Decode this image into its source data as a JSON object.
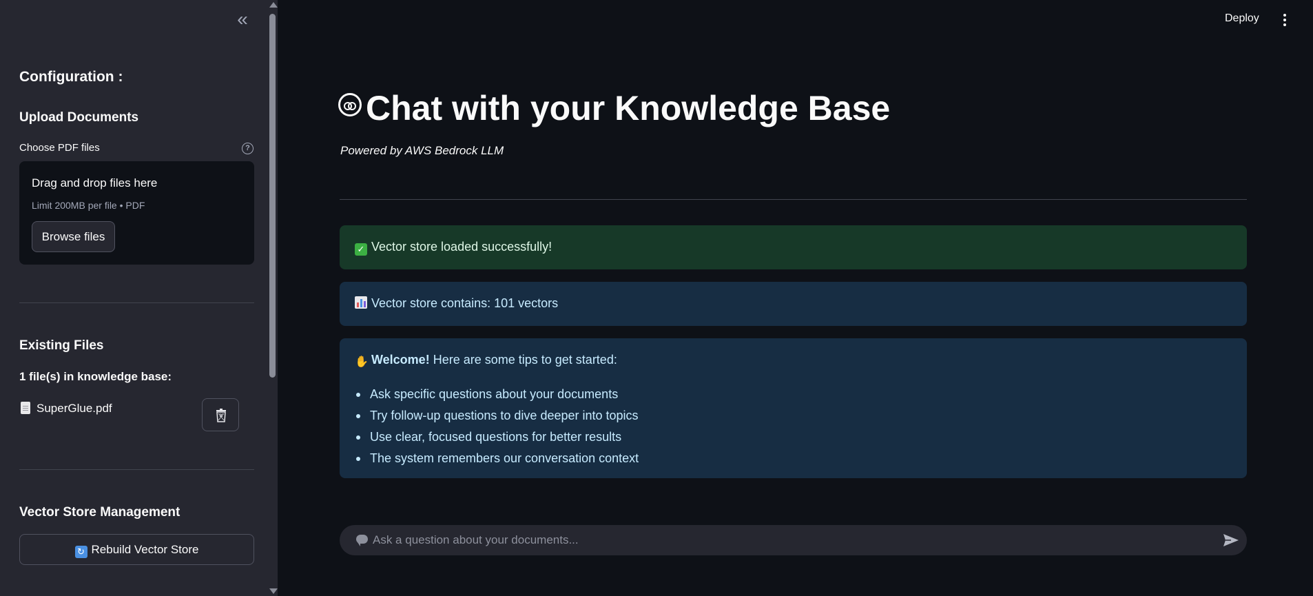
{
  "sidebar": {
    "collapse_label": "«",
    "heading": "Configuration :",
    "upload": {
      "heading": "Upload Documents",
      "label": "Choose PDF files",
      "help_icon": "question-icon",
      "dropzone_title": "Drag and drop files here",
      "dropzone_limit": "Limit 200MB per file • PDF",
      "browse_label": "Browse files"
    },
    "existing": {
      "heading": "Existing Files",
      "count_text": "1 file(s) in knowledge base:",
      "files": [
        {
          "name": "SuperGlue.pdf",
          "icon": "document-icon"
        }
      ],
      "delete_icon": "trash-icon"
    },
    "vector_store": {
      "heading": "Vector Store Management",
      "rebuild_label": "Rebuild Vector Store",
      "rebuild_icon": "refresh-icon"
    }
  },
  "header": {
    "deploy_label": "Deploy",
    "menu_icon": "kebab-menu-icon"
  },
  "main": {
    "title": "Chat with your Knowledge Base",
    "title_icon": "robot-face-icon",
    "subtitle": "Powered by AWS Bedrock LLM",
    "alerts": {
      "success": "Vector store loaded successfully!",
      "count": "Vector store contains: 101 vectors",
      "welcome_bold": "Welcome!",
      "welcome_rest": " Here are some tips to get started:",
      "tips": [
        "Ask specific questions about your documents",
        "Try follow-up questions to dive deeper into topics",
        "Use clear, focused questions for better results",
        "The system remembers our conversation context"
      ]
    },
    "chat": {
      "placeholder": "Ask a question about your documents...",
      "send_icon": "send-icon"
    }
  },
  "colors": {
    "background": "#0e1117",
    "sidebar": "#262730",
    "success_bg": "#173928",
    "info_bg": "#172d43",
    "text": "#fafafa"
  }
}
